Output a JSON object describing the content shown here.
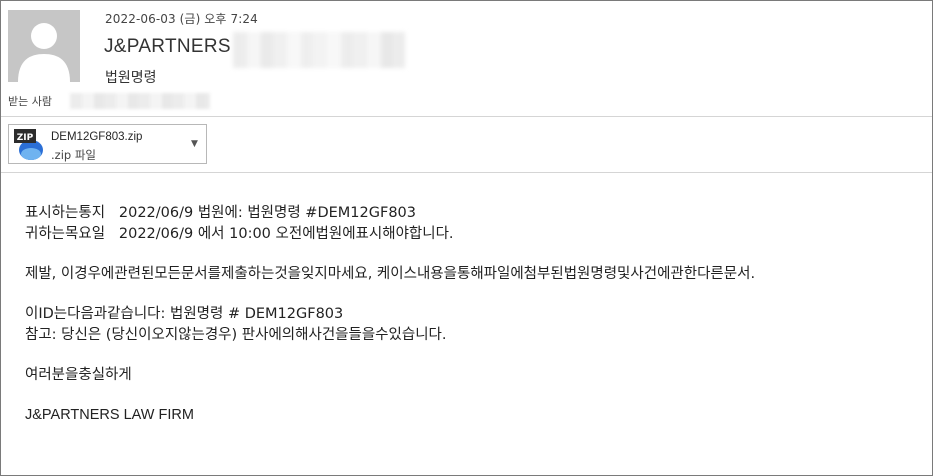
{
  "header": {
    "date": "2022-06-03 (금) 오후 7:24",
    "sender_name": "J&PARTNERS",
    "subject": "법원명령",
    "to_label": "받는 사람"
  },
  "attachment": {
    "file_name": "DEM12GF803.zip",
    "file_type": ".zip 파일",
    "icon_label": "ZIP"
  },
  "body": {
    "line1": "표시하는통지   2022/06/9 법원에: 법원명령 #DEM12GF803",
    "line2": "귀하는목요일   2022/06/9 에서 10:00 오전에법원에표시해야합니다.",
    "line3": "제발, 이경우에관련된모든문서를제출하는것을잊지마세요, 케이스내용을통해파일에첨부된법원명령및사건에관한다른문서.",
    "line4": "이ID는다음과같습니다: 법원명령 # DEM12GF803",
    "line5": "참고: 당신은 (당신이오지않는경우) 판사에의해사건을들을수있습니다.",
    "line6": "여러분을충실하게",
    "line7": "J&PARTNERS LAW FIRM"
  }
}
